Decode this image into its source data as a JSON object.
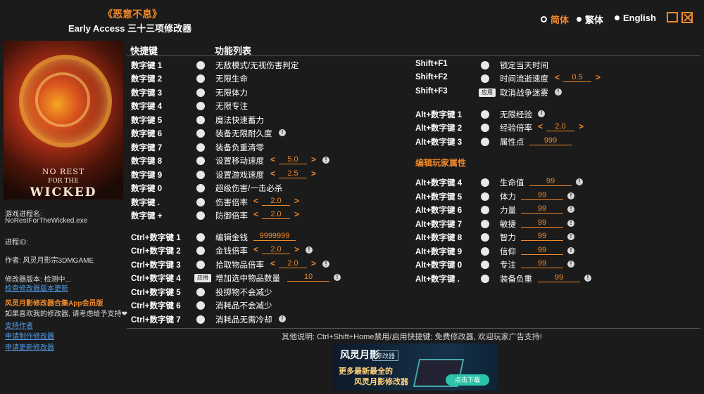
{
  "header": {
    "game_title": "《恶意不息》",
    "subtitle": "Early Access 三十三项修改器",
    "languages": [
      {
        "label": "简体",
        "active": true
      },
      {
        "label": "繁体",
        "active": false
      },
      {
        "label": "English",
        "active": false
      }
    ]
  },
  "cover": {
    "line1": "NO REST",
    "line2": "FOR THE",
    "line3": "WICKED"
  },
  "sidebar": {
    "process_label": "游戏进程名:",
    "process_name": "NoRestForTheWicked.exe",
    "pid_label": "进程ID:",
    "author": "作者: 风灵月影宗3DMGAME",
    "version": "修改器版本: 检测中...",
    "check_link": "检查修改器版本更新",
    "promo": "风灵月影修改器合集App会员版",
    "support": "如果喜欢我的修改器, 请考虑给予支持❤",
    "links": [
      "支持作者",
      "申请制作修改器",
      "申请更新修改器"
    ]
  },
  "columns": {
    "hotkey": "快捷键",
    "function": "功能列表"
  },
  "left_rows": [
    {
      "hk": "数字键 1",
      "fn": "无敌模式/无视伤害判定"
    },
    {
      "hk": "数字键 2",
      "fn": "无限生命"
    },
    {
      "hk": "数字键 3",
      "fn": "无限体力"
    },
    {
      "hk": "数字键 4",
      "fn": "无限专注"
    },
    {
      "hk": "数字键 5",
      "fn": "魔法快速蓄力"
    },
    {
      "hk": "数字键 6",
      "fn": "装备无限耐久度",
      "info": true
    },
    {
      "hk": "数字键 7",
      "fn": "装备负重清零"
    },
    {
      "hk": "数字键 8",
      "fn": "设置移动速度",
      "value": "5.0",
      "info": true
    },
    {
      "hk": "数字键 9",
      "fn": "设置游戏速度",
      "value": "2.5"
    },
    {
      "hk": "数字键 0",
      "fn": "超级伤害/一击必杀"
    },
    {
      "hk": "数字键 .",
      "fn": "伤害倍率",
      "value": "2.0"
    },
    {
      "hk": "数字键 +",
      "fn": "防御倍率",
      "value": "2.0"
    },
    {
      "hk": "Ctrl+数字键 1",
      "fn": "编辑金钱",
      "edit": "9999999"
    },
    {
      "hk": "Ctrl+数字键 2",
      "fn": "金钱倍率",
      "value": "2.0",
      "info": true
    },
    {
      "hk": "Ctrl+数字键 3",
      "fn": "拾取物品倍率",
      "value": "2.0",
      "info": true
    },
    {
      "hk": "Ctrl+数字键 4",
      "fn": "增加选中物品数量",
      "apply": "应用",
      "edit": "10",
      "info": true
    },
    {
      "hk": "Ctrl+数字键 5",
      "fn": "投掷物不会减少"
    },
    {
      "hk": "Ctrl+数字键 6",
      "fn": "消耗品不会减少"
    },
    {
      "hk": "Ctrl+数字键 7",
      "fn": "消耗品无需冷却",
      "info": true
    }
  ],
  "right_rows": [
    {
      "hk": "Shift+F1",
      "fn": "锁定当天时间"
    },
    {
      "hk": "Shift+F2",
      "fn": "时间流逝速度",
      "value": "0.5"
    },
    {
      "hk": "Shift+F3",
      "fn": "取消战争迷雾",
      "apply": "应用",
      "info": true
    },
    {
      "hk": "Alt+数字键 1",
      "fn": "无限经验",
      "info": true
    },
    {
      "hk": "Alt+数字键 2",
      "fn": "经验倍率",
      "value": "2.0"
    },
    {
      "hk": "Alt+数字键 3",
      "fn": "属性点",
      "edit": "999"
    }
  ],
  "stats_section": "编辑玩家属性",
  "stat_rows": [
    {
      "hk": "Alt+数字键 4",
      "fn": "生命值",
      "edit": "99",
      "info": true
    },
    {
      "hk": "Alt+数字键 5",
      "fn": "体力",
      "edit": "99",
      "info": true
    },
    {
      "hk": "Alt+数字键 6",
      "fn": "力量",
      "edit": "99",
      "info": true
    },
    {
      "hk": "Alt+数字键 7",
      "fn": "敏捷",
      "edit": "99",
      "info": true
    },
    {
      "hk": "Alt+数字键 8",
      "fn": "智力",
      "edit": "99",
      "info": true
    },
    {
      "hk": "Alt+数字键 9",
      "fn": "信仰",
      "edit": "99",
      "info": true
    },
    {
      "hk": "Alt+数字键 0",
      "fn": "专注",
      "edit": "99",
      "info": true
    },
    {
      "hk": "Alt+数字键 .",
      "fn": "装备负重",
      "edit": "99",
      "info": true
    }
  ],
  "footer": {
    "note": "其他说明: Ctrl+Shift+Home禁用/启用快捷键; 免费修改器, 欢迎玩家广告支持!"
  },
  "ad": {
    "brand": "风灵月影",
    "tag": "修改器",
    "line1": "更多最新最全的",
    "line2": "风灵月影修改器",
    "button": "点击下载"
  },
  "colors": {
    "accent": "#f0892a",
    "background": "#1b1b1b",
    "link": "#4f9be8"
  }
}
